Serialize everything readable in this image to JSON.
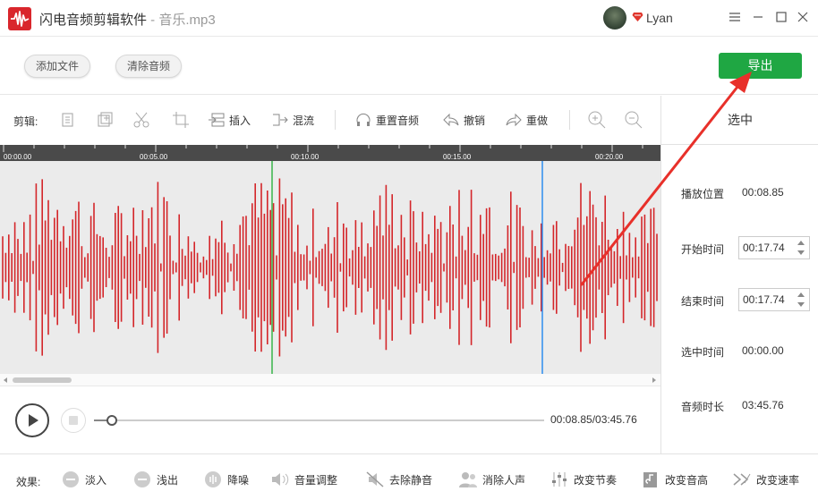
{
  "window": {
    "app_name": "闪电音频剪辑软件",
    "separator": " - ",
    "file_name": "音乐.mp3",
    "username": "Lyan"
  },
  "toolbar": {
    "add_file": "添加文件",
    "clear_audio": "清除音频",
    "export": "导出"
  },
  "edit": {
    "label": "剪辑:",
    "insert": "插入",
    "mix": "混流",
    "reset_audio": "重置音频",
    "undo": "撤销",
    "redo": "重做"
  },
  "timeline": {
    "ticks": [
      "00:00.00",
      "00:05.00",
      "00:10.00",
      "00:15.00",
      "00:20.00"
    ]
  },
  "selection_panel": {
    "title": "选中",
    "play_position_label": "播放位置",
    "play_position": "00:08.85",
    "start_time_label": "开始时间",
    "start_time": "00:17.74",
    "end_time_label": "结束时间",
    "end_time": "00:17.74",
    "selected_duration_label": "选中时间",
    "selected_duration": "00:00.00",
    "audio_length_label": "音频时长",
    "audio_length": "03:45.76"
  },
  "transport": {
    "time_readout": "00:08.85/03:45.76",
    "progress_fraction": 0.039
  },
  "effects": {
    "label": "效果:",
    "fade_in": "淡入",
    "fade_out": "浅出",
    "denoise": "降噪",
    "volume": "音量调整",
    "remove_silence": "去除静音",
    "remove_vocals": "消除人声",
    "change_tempo": "改变节奏",
    "change_pitch": "改变音高",
    "change_speed": "改变速率"
  },
  "colors": {
    "brand_red": "#d9262c",
    "export_green": "#1fa743",
    "waveform_red": "#d4262a",
    "playhead_green": "#39b54a",
    "marker_blue": "#2d8ef0",
    "annotation_arrow": "#e8302a"
  }
}
